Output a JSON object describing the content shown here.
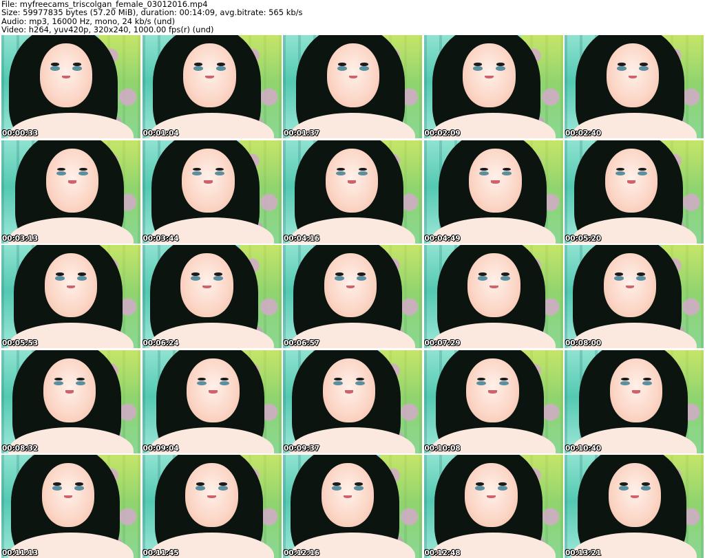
{
  "header": {
    "file_line": "File: myfreecams_triscolgan_female_03012016.mp4",
    "size_line": "Size: 59977835 bytes (57.20 MiB), duration: 00:14:09, avg.bitrate: 565 kb/s",
    "audio_line": "Audio: mp3, 16000 Hz, mono, 24 kb/s (und)",
    "video_line": "Video: h264, yuv420p, 320x240, 1000.00 fps(r) (und)"
  },
  "timestamps": [
    "00:00:33",
    "00:01:04",
    "00:01:37",
    "00:02:09",
    "00:02:40",
    "00:03:13",
    "00:03:44",
    "00:04:16",
    "00:04:49",
    "00:05:20",
    "00:05:53",
    "00:06:24",
    "00:06:57",
    "00:07:29",
    "00:08:00",
    "00:08:32",
    "00:09:04",
    "00:09:37",
    "00:10:08",
    "00:10:40",
    "00:11:13",
    "00:11:45",
    "00:12:16",
    "00:12:48",
    "00:13:21"
  ]
}
